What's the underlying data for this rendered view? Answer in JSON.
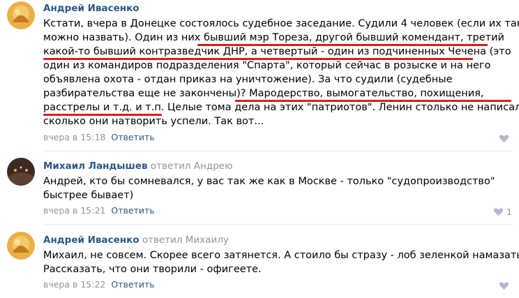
{
  "comments": [
    {
      "author": "Андрей Ивасенко",
      "reply_to": "",
      "lines": [
        "Кстати, вчера в Донецке состоялось судебное заседание. Судили 4 человек (если их так",
        "можно назвать). Один из них бывший мэр Тореза, другой бывший комендант, третий",
        "какой-то бывший контразведчик ДНР, а четвертый - один из подчиненных Чечена (это",
        "один из командиров подразделения \"Спарта\", который сейчас в розыске и на него",
        "объявлена охота - отдан приказ на уничтожение). За что судили (судебные",
        "разбирательства еще не закончены)? Мародерство, вымогательство, похищения,",
        "расстрелы и т.д. и т.п. Целые тома дела на этих \"патриотов\". Ленин столько не написал,",
        "сколько они натворить успели. Так вот..."
      ],
      "date": "вчера в 15:18",
      "reply_label": "Ответить",
      "like_count": ""
    },
    {
      "author": "Михаил Ландышев",
      "reply_to": "ответил Андрею",
      "lines": [
        "Андрей, кто бы сомневался, у вас так же как в Москве - только \"судопроизводство\"",
        "быстрее бывает)"
      ],
      "date": "вчера в 15:21",
      "reply_label": "Ответить",
      "like_count": "1"
    },
    {
      "author": "Андрей Ивасенко",
      "reply_to": "ответил Михаилу",
      "lines": [
        "Михаил, не совсем. Скорее всего затянется. А стоило бы стразу - лоб зеленкой намазать.",
        "Рассказать, что они творили - офигеете."
      ],
      "date": "вчера в 15:22",
      "reply_label": "Ответить",
      "like_count": ""
    }
  ],
  "colors": {
    "author": "#2a5885",
    "meta": "#939393",
    "underline": "#e01b1b",
    "divider": "#e7e8ec"
  },
  "icons": {
    "like": "heart-icon"
  }
}
